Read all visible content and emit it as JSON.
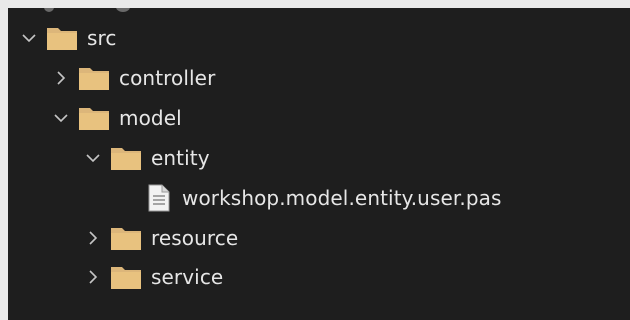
{
  "tree": {
    "nodes": [
      {
        "label": "src",
        "type": "folder",
        "expanded": true,
        "depth": 0,
        "name": "tree-node-src"
      },
      {
        "label": "controller",
        "type": "folder",
        "expanded": false,
        "depth": 1,
        "name": "tree-node-controller"
      },
      {
        "label": "model",
        "type": "folder",
        "expanded": true,
        "depth": 1,
        "name": "tree-node-model"
      },
      {
        "label": "entity",
        "type": "folder",
        "expanded": true,
        "depth": 2,
        "name": "tree-node-entity"
      },
      {
        "label": "workshop.model.entity.user.pas",
        "type": "file",
        "depth": 3,
        "name": "tree-node-user-pas"
      },
      {
        "label": "resource",
        "type": "folder",
        "expanded": false,
        "depth": 2,
        "name": "tree-node-resource"
      },
      {
        "label": "service",
        "type": "folder",
        "expanded": false,
        "depth": 2,
        "name": "tree-node-service"
      }
    ]
  },
  "icons": {
    "folder": "folder-icon",
    "file": "file-icon",
    "expanded": "chevron-down-icon",
    "collapsed": "chevron-right-icon"
  },
  "colors": {
    "panel_background": "#1e1e1e",
    "text": "#e6e6e6",
    "folder": "#dcb67a",
    "chevron": "#c5c5c5"
  }
}
